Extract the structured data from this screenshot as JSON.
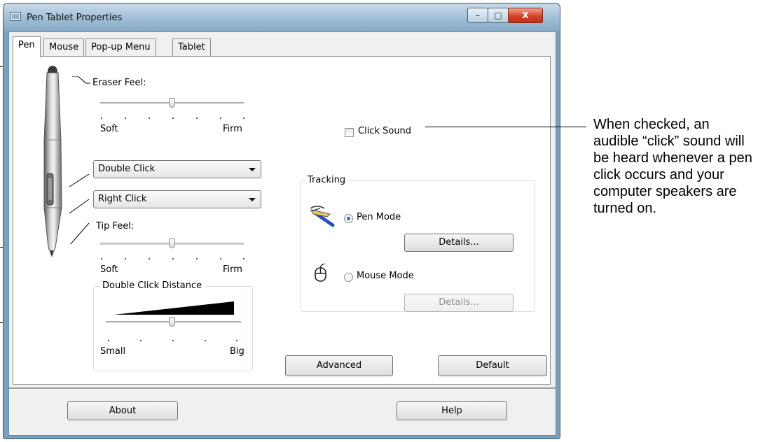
{
  "window": {
    "title": "Pen Tablet Properties",
    "controls": {
      "minimize": "–",
      "maximize": "□",
      "close": "X"
    }
  },
  "tabs": [
    {
      "label": "Pen",
      "active": true
    },
    {
      "label": "Mouse",
      "active": false
    },
    {
      "label": "Pop-up Menu",
      "active": false
    },
    {
      "label": "Tablet",
      "active": false
    }
  ],
  "eraser_feel": {
    "label": "Eraser Feel:",
    "min_label": "Soft",
    "max_label": "Firm",
    "level": 0.5
  },
  "buttons_config": {
    "upper_button": "Double Click",
    "lower_button": "Right Click"
  },
  "tip_feel": {
    "label": "Tip Feel:",
    "min_label": "Soft",
    "max_label": "Firm",
    "level": 0.5
  },
  "double_click_distance": {
    "title": "Double Click Distance",
    "min_label": "Small",
    "max_label": "Big",
    "level": 0.5
  },
  "click_sound": {
    "label": "Click Sound",
    "checked": false
  },
  "tracking": {
    "title": "Tracking",
    "pen_mode": {
      "label": "Pen Mode",
      "selected": true,
      "details_label": "Details..."
    },
    "mouse_mode": {
      "label": "Mouse Mode",
      "selected": false,
      "details_label": "Details..."
    }
  },
  "actions": {
    "advanced_label": "Advanced",
    "default_label": "Default"
  },
  "footer": {
    "about_label": "About",
    "help_label": "Help"
  },
  "callout": {
    "text": "When checked, an audible “click” sound will be heard whenever a pen click occurs and your computer speakers are turned on."
  },
  "colors": {
    "radio_selected": "#2f6cc1",
    "close_button": "#d2432a",
    "title_bar": "#9dbbd4"
  }
}
